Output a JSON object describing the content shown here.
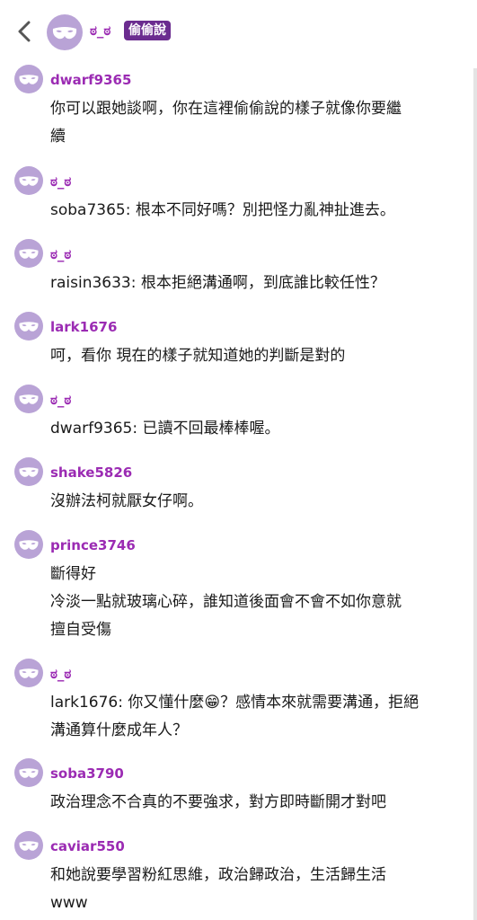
{
  "header": {
    "name": "ಠ_ಠ",
    "badge": "偷偷說"
  },
  "messages": [
    {
      "username": "dwarf9365",
      "lines": [
        "你可以跟她談啊，你在這裡偷偷說的樣子就像你要繼",
        "續"
      ]
    },
    {
      "username": "ಠ_ಠ",
      "lines": [
        "soba7365: 根本不同好嗎？別把怪力亂神扯進去。"
      ]
    },
    {
      "username": "ಠ_ಠ",
      "lines": [
        "raisin3633: 根本拒絕溝通啊，到底誰比較任性？"
      ]
    },
    {
      "username": "lark1676",
      "lines": [
        "呵，看你 現在的樣子就知道她的判斷是對的"
      ]
    },
    {
      "username": "ಠ_ಠ",
      "lines": [
        "dwarf9365: 已讀不回最棒棒喔。"
      ]
    },
    {
      "username": "shake5826",
      "lines": [
        "沒辦法柯就厭女仔啊。"
      ]
    },
    {
      "username": "prince3746",
      "lines": [
        "斷得好",
        "冷淡一點就玻璃心碎，誰知道後面會不會不如你意就",
        "擅自受傷"
      ]
    },
    {
      "username": "ಠ_ಠ",
      "lines": [
        "lark1676: 你又懂什麼😁？感情本來就需要溝通，拒絕",
        "溝通算什麼成年人？"
      ]
    },
    {
      "username": "soba3790",
      "lines": [
        "政治理念不合真的不要強求，對方即時斷開才對吧"
      ]
    },
    {
      "username": "caviar550",
      "lines": [
        "和她說要學習粉紅思維，政治歸政治，生活歸生活",
        "www"
      ]
    }
  ]
}
